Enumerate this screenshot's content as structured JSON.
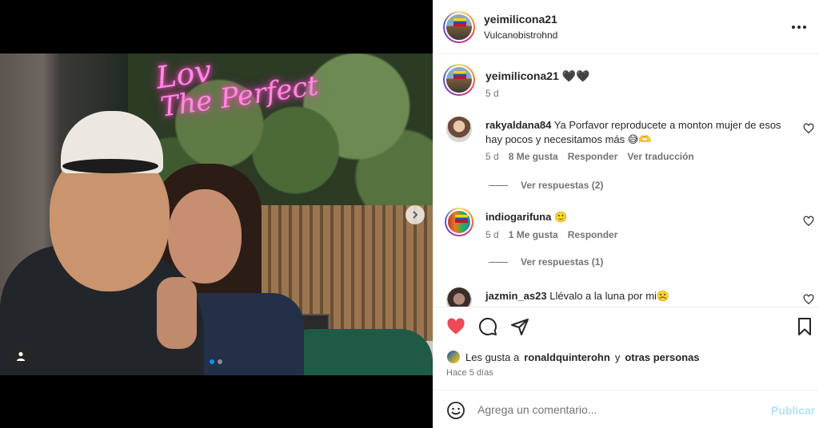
{
  "post": {
    "username": "yeimilicona21",
    "location": "Vulcanobistrohnd",
    "photo_neon_line1": "Lov",
    "photo_neon_line2": "The Perfect",
    "carousel_total": 2,
    "carousel_index": 1
  },
  "caption": {
    "username": "yeimilicona21",
    "text": "🖤🖤",
    "time": "5 d"
  },
  "comments": [
    {
      "username": "rakyaldana84",
      "text": "Ya Porfavor reproducete a monton mujer de esos hay pocos y necesitamos más 😅🫶",
      "time": "5 d",
      "likes": "8 Me gusta",
      "reply": "Responder",
      "translate": "Ver traducción",
      "replies": "Ver respuestas (2)"
    },
    {
      "username": "indiogarifuna",
      "text": "🙂",
      "time": "5 d",
      "likes": "1 Me gusta",
      "reply": "Responder",
      "replies": "Ver respuestas (1)"
    },
    {
      "username": "jazmin_as23",
      "text": "Llévalo a la luna por mi☹️"
    }
  ],
  "likes_summary": {
    "prefix": "Les gusta a",
    "user": "ronaldquinterohn",
    "connector": "y",
    "others": "otras personas"
  },
  "posted_when": "Hace 5 días",
  "comment_box": {
    "placeholder": "Agrega un comentario...",
    "publish": "Publicar"
  },
  "colors": {
    "heart_liked": "#ed4956",
    "link_blue_disabled": "#b2dffc",
    "carousel_active": "#0095f6"
  },
  "icons": [
    "more-options-icon",
    "heart-icon",
    "comment-icon",
    "share-icon",
    "bookmark-icon",
    "emoji-icon",
    "chevron-right-icon",
    "user-tag-icon"
  ]
}
